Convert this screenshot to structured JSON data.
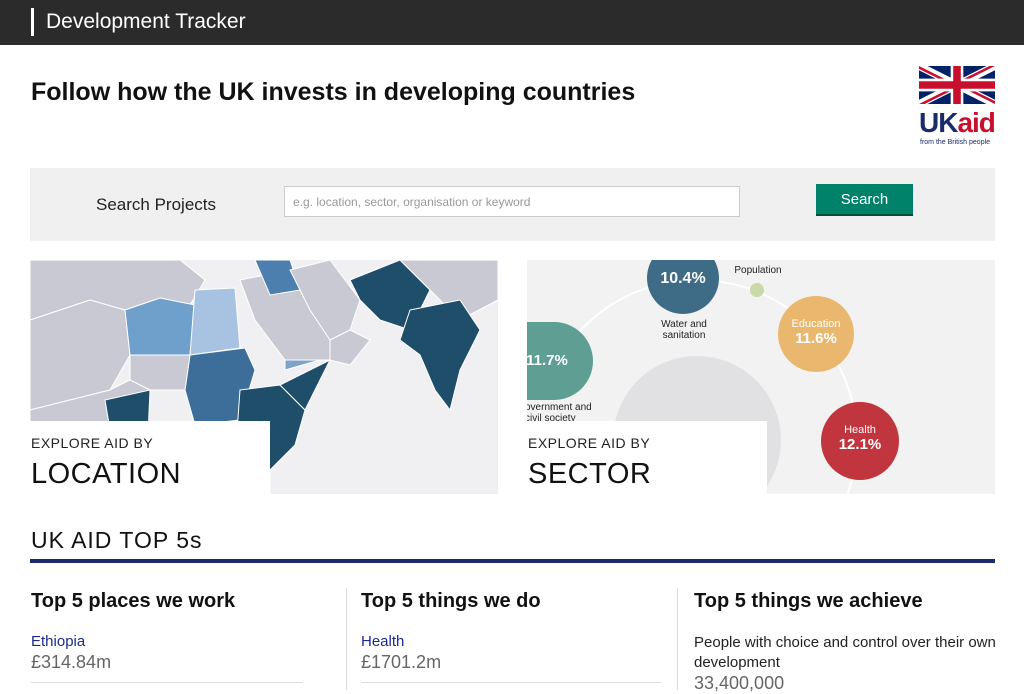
{
  "topbar": {
    "title": "Development Tracker"
  },
  "headline": "Follow how the UK invests in developing countries",
  "logo": {
    "uk": "UK",
    "aid": "aid",
    "tagline": "from the British people"
  },
  "search": {
    "label": "Search Projects",
    "placeholder": "e.g. location, sector, organisation or keyword",
    "button": "Search"
  },
  "explore_location": {
    "small": "EXPLORE AID BY",
    "big": "LOCATION"
  },
  "explore_sector": {
    "small": "EXPLORE AID BY",
    "big": "SECTOR",
    "bubbles": [
      {
        "label": "",
        "value": "10.4%",
        "caption": "Water and sanitation",
        "color": "#3e6b86"
      },
      {
        "label": "",
        "value": "",
        "caption": "Population",
        "color": "#c9d9a8"
      },
      {
        "label": "Education",
        "value": "11.6%",
        "caption": "",
        "color": "#e9b86e"
      },
      {
        "label": "",
        "value": "11.7%",
        "caption": "overnment and civil society",
        "color": "#5f9e92"
      },
      {
        "label": "Health",
        "value": "12.1%",
        "caption": "",
        "color": "#c0353e"
      }
    ]
  },
  "top5": {
    "heading": "UK AID TOP 5s",
    "columns": [
      {
        "title": "Top 5 places we work",
        "item": "Ethiopia",
        "value": "£314.84m"
      },
      {
        "title": "Top 5 things we do",
        "item": "Health",
        "value": "£1701.2m"
      },
      {
        "title": "Top 5 things we achieve",
        "desc": "People with choice and control over their own development",
        "value": "33,400,000"
      }
    ]
  }
}
